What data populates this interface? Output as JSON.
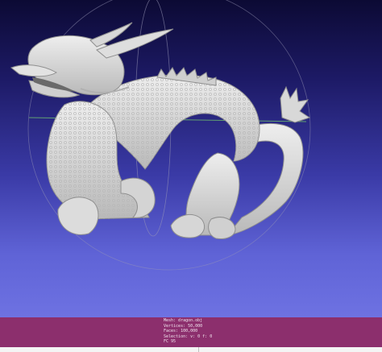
{
  "window": {
    "background_top": "#0c0a34",
    "background_bottom": "#6e72e2",
    "mesh_color": "#d9d9d9",
    "trackball_color": "#9a98b8",
    "trackball_axis_color": "#6fbf6f"
  },
  "info_bar": {
    "background": "#8c2f6d",
    "mesh": "Mesh: dragon.obj",
    "vertices": "Vertices: 50,000",
    "faces": "Faces: 100,000",
    "selection": "Selection: v: 0 f: 0",
    "fps": "FC 95"
  }
}
